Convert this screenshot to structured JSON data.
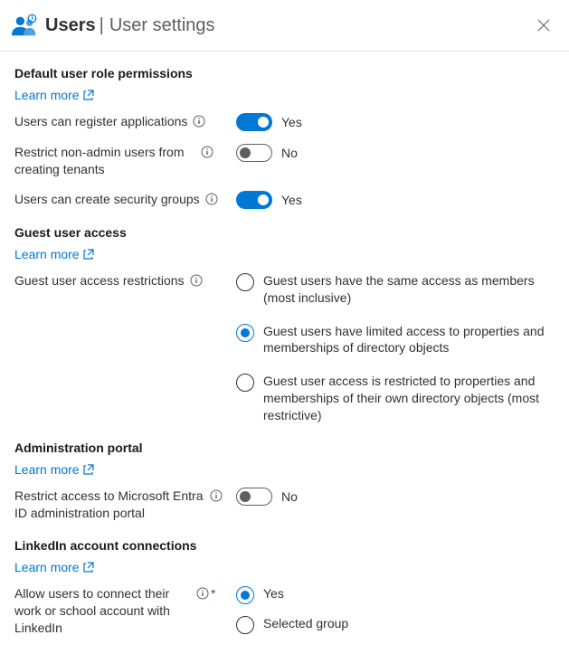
{
  "header": {
    "title": "Users",
    "subtitle": "User settings"
  },
  "sections": {
    "defaultRole": {
      "heading": "Default user role permissions",
      "learnMore": "Learn more",
      "registerApps": {
        "label": "Users can register applications",
        "value": "Yes",
        "on": true
      },
      "restrictTenants": {
        "label": "Restrict non-admin users from creating tenants",
        "value": "No",
        "on": false
      },
      "securityGroups": {
        "label": "Users can create security groups",
        "value": "Yes",
        "on": true
      }
    },
    "guestAccess": {
      "heading": "Guest user access",
      "learnMore": "Learn more",
      "restrictions": {
        "label": "Guest user access restrictions",
        "options": [
          "Guest users have the same access as members (most inclusive)",
          "Guest users have limited access to properties and memberships of directory objects",
          "Guest user access is restricted to properties and memberships of their own directory objects (most restrictive)"
        ],
        "selectedIndex": 1
      }
    },
    "adminPortal": {
      "heading": "Administration portal",
      "learnMore": "Learn more",
      "restrictAccess": {
        "label": "Restrict access to Microsoft Entra ID administration portal",
        "value": "No",
        "on": false
      }
    },
    "linkedin": {
      "heading": "LinkedIn account connections",
      "learnMore": "Learn more",
      "allowConnect": {
        "label": "Allow users to connect their work or school account with LinkedIn",
        "options": [
          "Yes",
          "Selected group"
        ],
        "selectedIndex": 0
      }
    }
  }
}
